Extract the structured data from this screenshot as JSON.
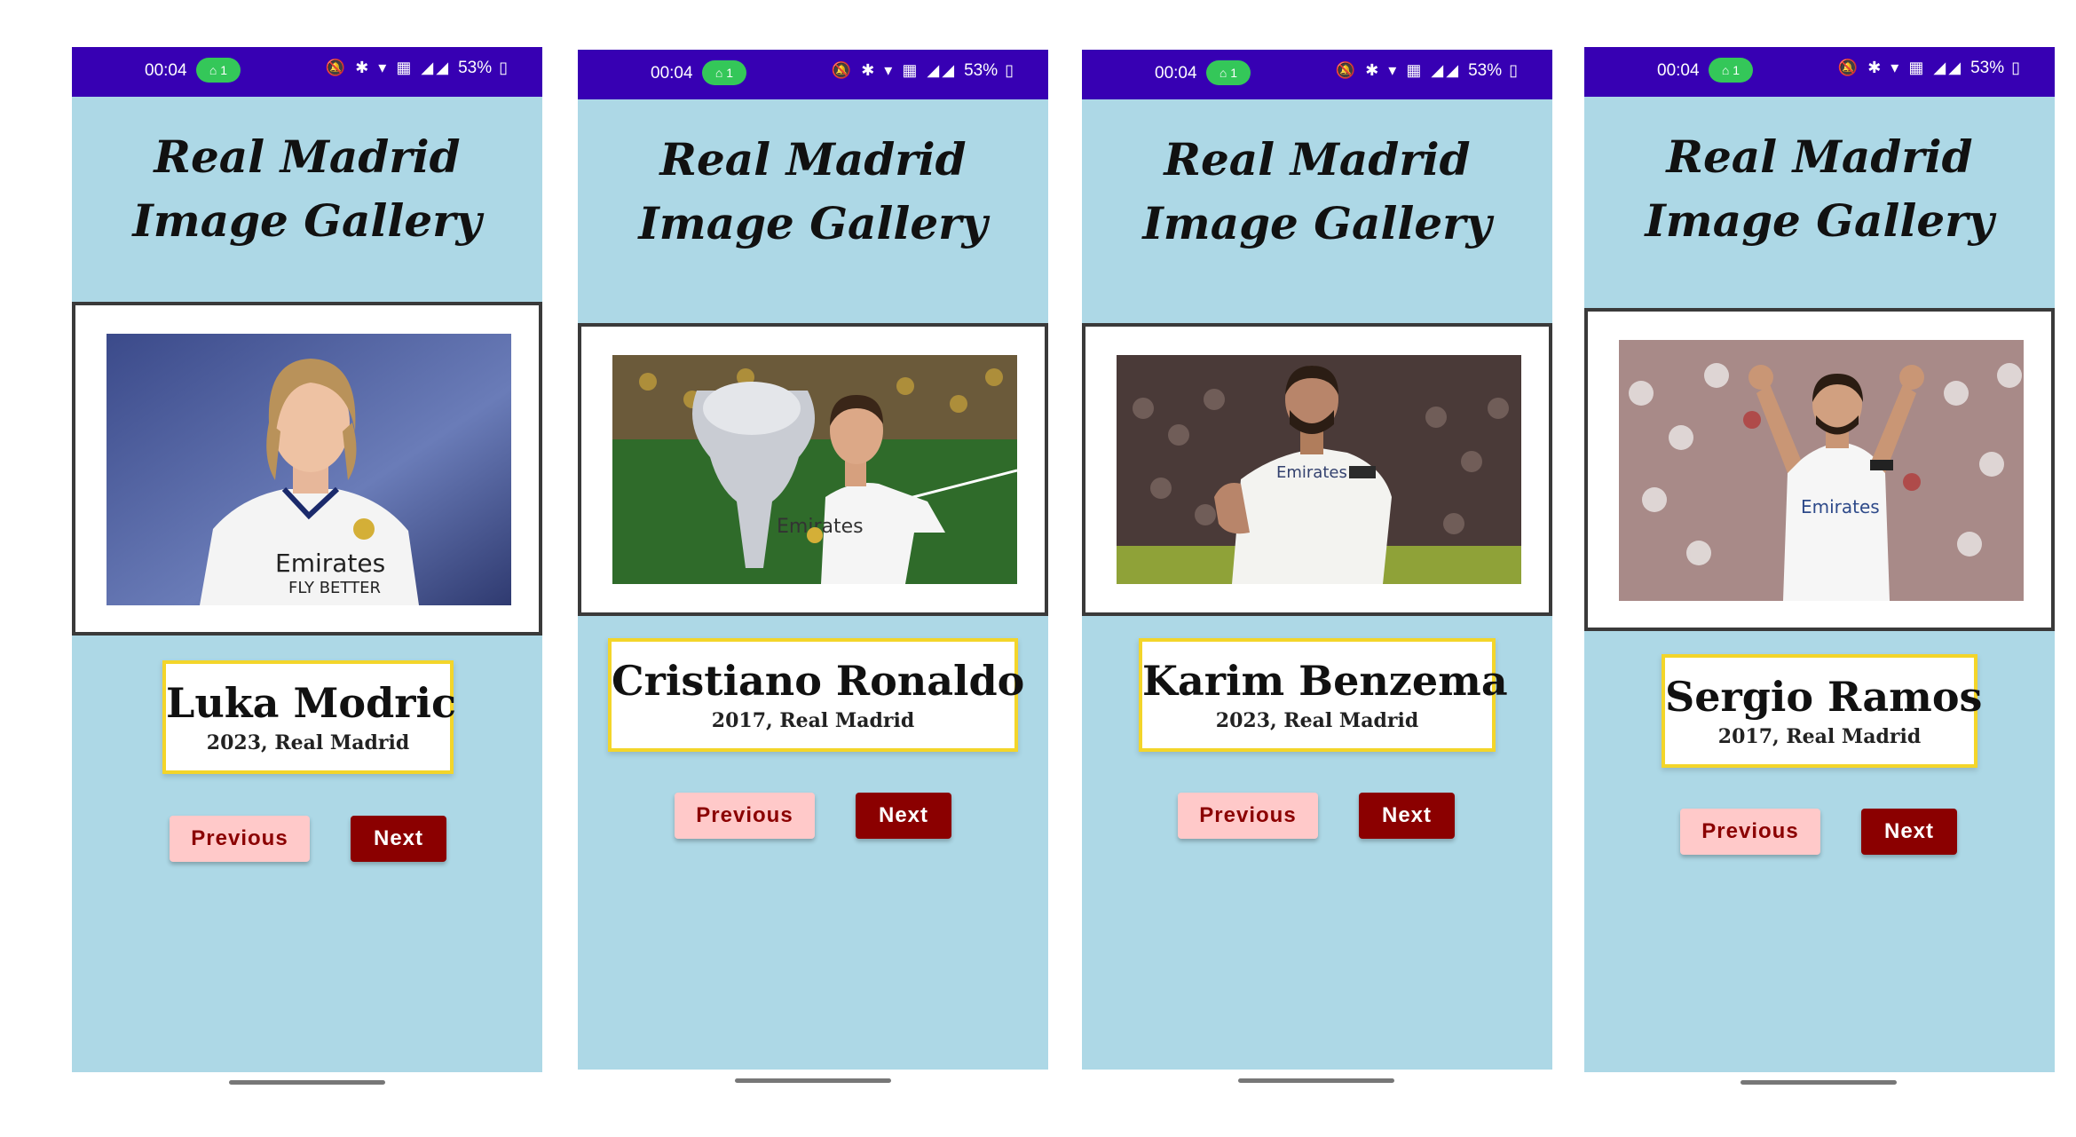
{
  "screens": [
    {
      "status": {
        "time": "00:04",
        "pill": "1",
        "icons": "🔕 ✱ ▾ ▦ ◢◢",
        "battery": "53%"
      },
      "title_line1": "Real Madrid",
      "title_line2": "Image Gallery",
      "player_name": "Luka Modric",
      "player_sub": "2023, Real Madrid",
      "prev_label": "Previous",
      "next_label": "Next"
    },
    {
      "status": {
        "time": "00:04",
        "pill": "1",
        "icons": "🔕 ✱ ▾ ▦ ◢◢",
        "battery": "53%"
      },
      "title_line1": "Real Madrid",
      "title_line2": "Image Gallery",
      "player_name": "Cristiano Ronaldo",
      "player_sub": "2017, Real Madrid",
      "prev_label": "Previous",
      "next_label": "Next"
    },
    {
      "status": {
        "time": "00:04",
        "pill": "1",
        "icons": "🔕 ✱ ▾ ▦ ◢◢",
        "battery": "53%"
      },
      "title_line1": "Real Madrid",
      "title_line2": "Image Gallery",
      "player_name": "Karim Benzema",
      "player_sub": "2023, Real Madrid",
      "prev_label": "Previous",
      "next_label": "Next"
    },
    {
      "status": {
        "time": "00:04",
        "pill": "1",
        "icons": "🔕 ✱ ▾ ▦ ◢◢",
        "battery": "53%"
      },
      "title_line1": "Real Madrid",
      "title_line2": "Image Gallery",
      "player_name": "Sergio Ramos",
      "player_sub": "2017, Real Madrid",
      "prev_label": "Previous",
      "next_label": "Next"
    }
  ],
  "colors": {
    "status_bar": "#3700b3",
    "background": "#add8e6",
    "card_border": "#f3d52a",
    "next_button": "#8b0000",
    "prev_button": "#ffc9c9"
  }
}
